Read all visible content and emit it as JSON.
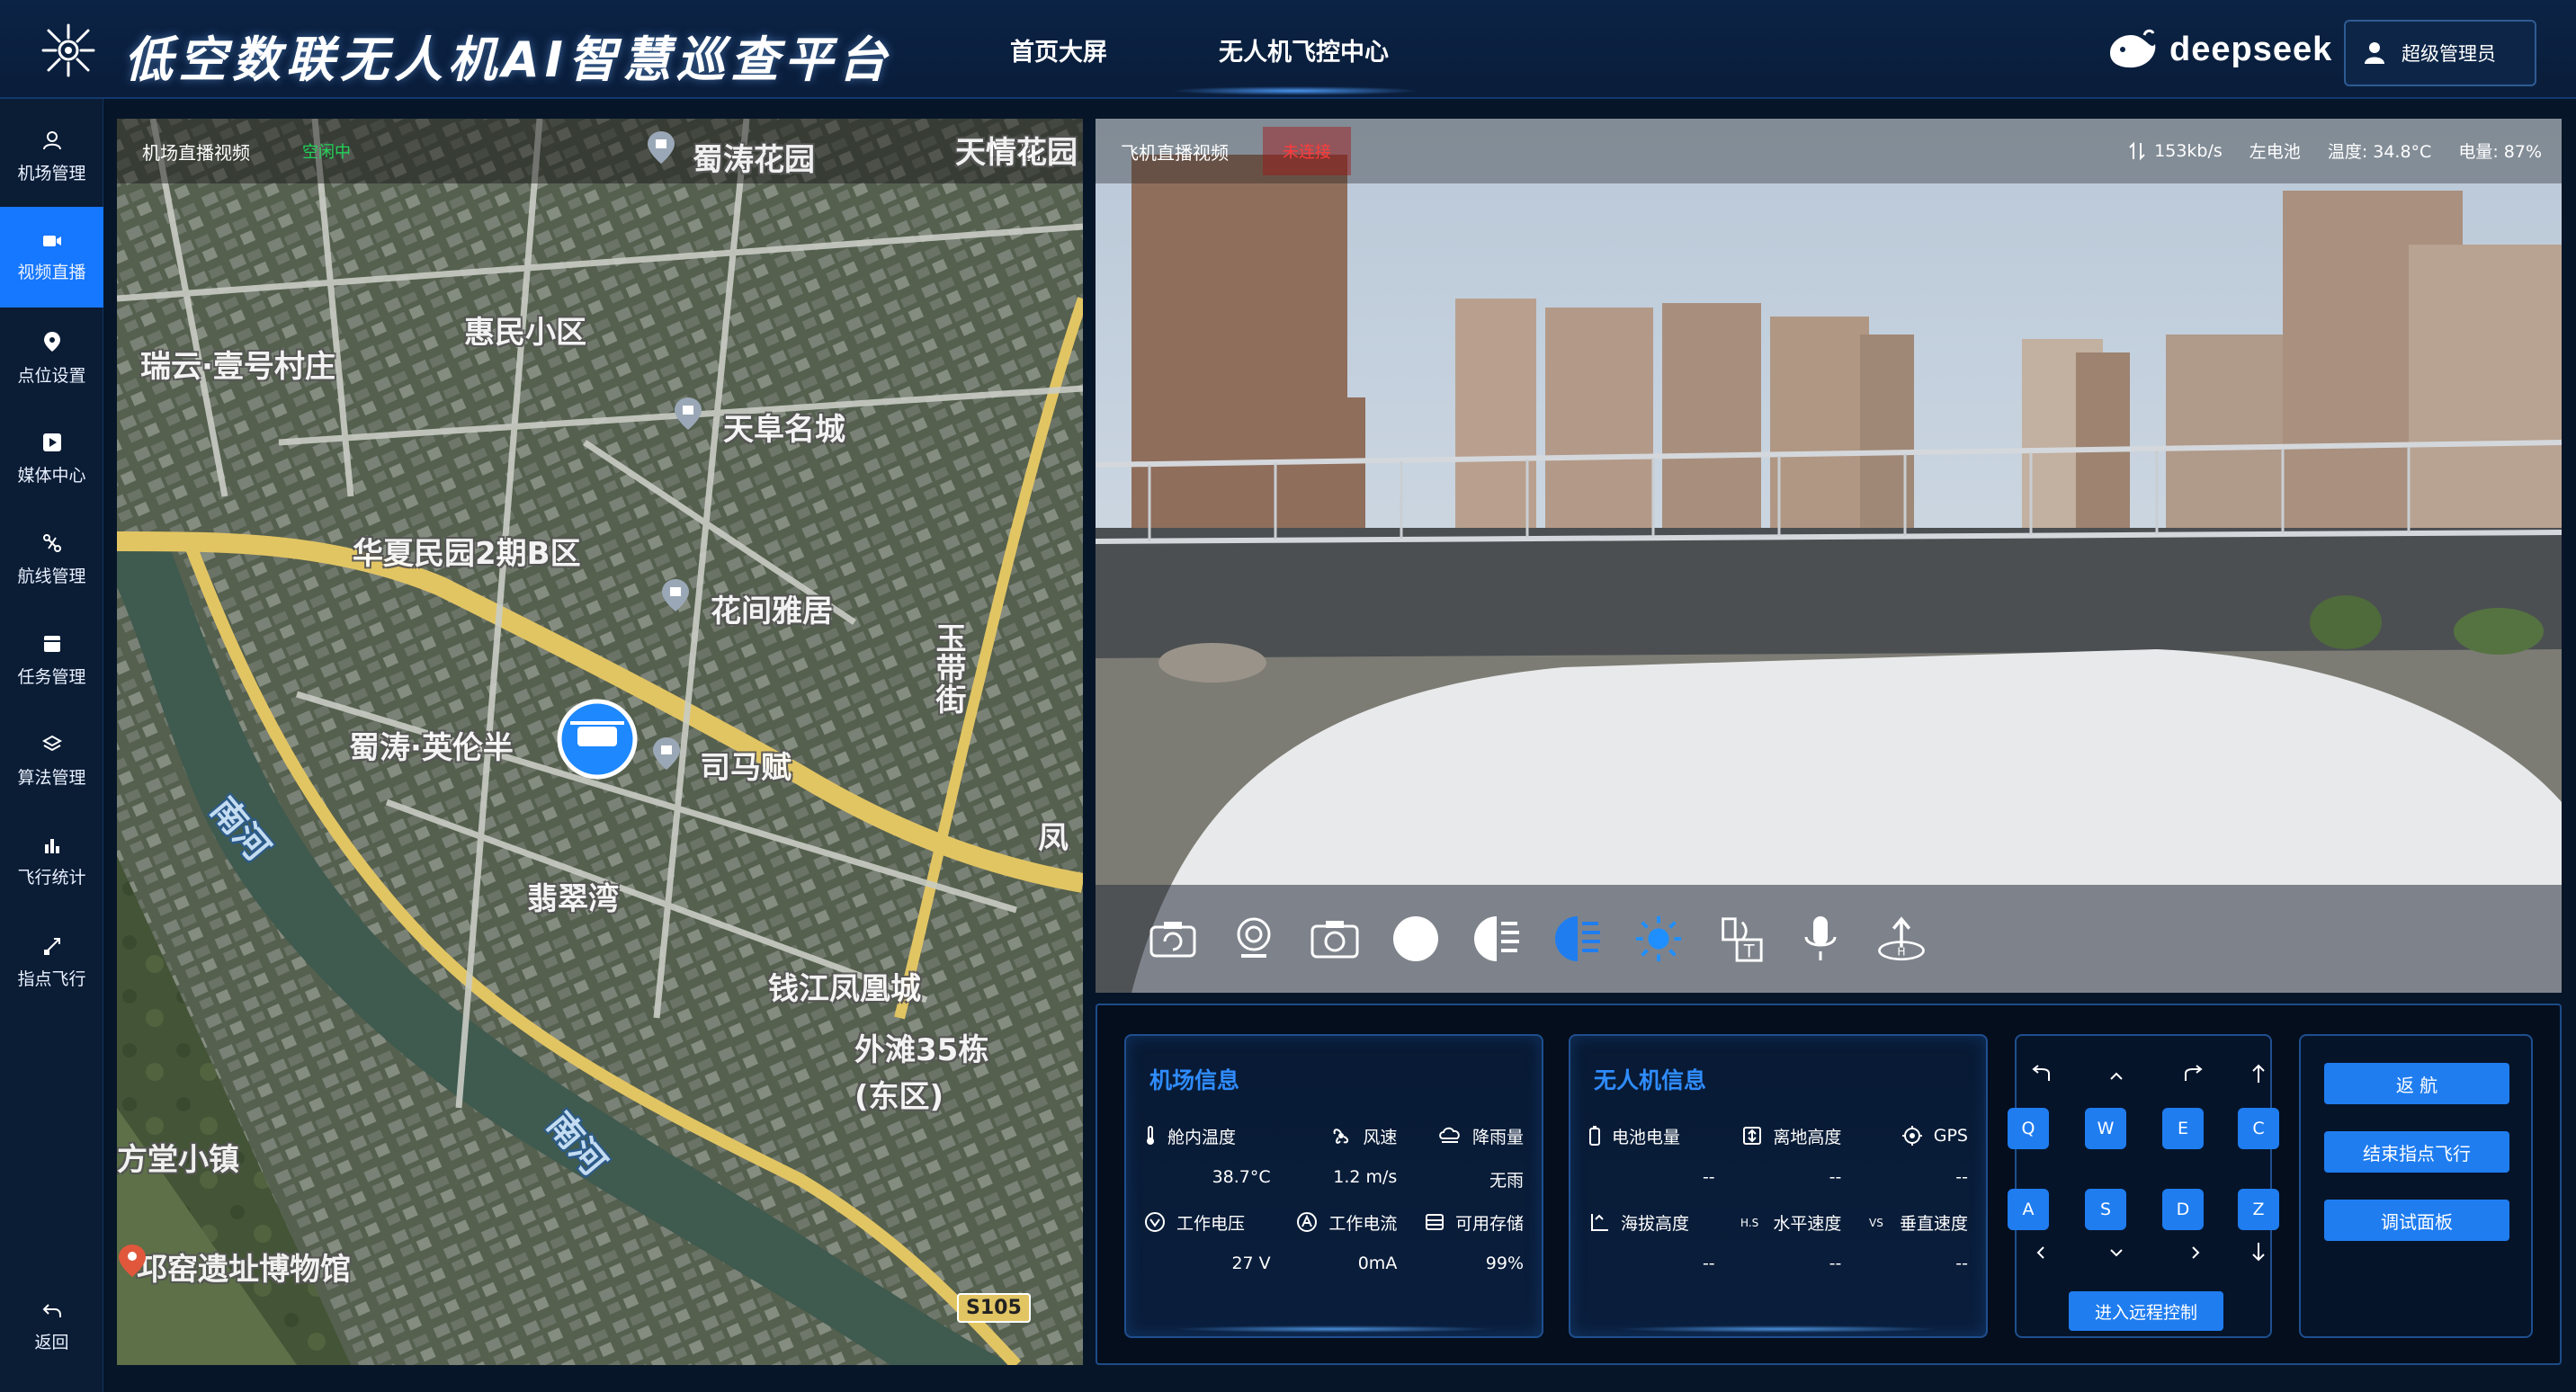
{
  "header": {
    "title": "低空数联无人机AI智慧巡查平台",
    "nav": [
      {
        "label": "首页大屏"
      },
      {
        "label": "无人机飞控中心"
      }
    ],
    "brand": "deepseek",
    "user": "超级管理员"
  },
  "sidebar": {
    "items": [
      {
        "label": "机场管理",
        "icon": "drone-user-icon"
      },
      {
        "label": "视频直播",
        "icon": "video-icon",
        "active": true
      },
      {
        "label": "点位设置",
        "icon": "location-pin-icon"
      },
      {
        "label": "媒体中心",
        "icon": "media-play-icon"
      },
      {
        "label": "航线管理",
        "icon": "route-icon"
      },
      {
        "label": "任务管理",
        "icon": "task-icon"
      },
      {
        "label": "算法管理",
        "icon": "algorithm-icon"
      },
      {
        "label": "飞行统计",
        "icon": "bar-chart-icon"
      },
      {
        "label": "指点飞行",
        "icon": "point-flight-icon"
      }
    ],
    "back": "返回"
  },
  "map_panel": {
    "title": "机场直播视频",
    "status": "空闲中",
    "labels": [
      {
        "text": "蜀涛花园"
      },
      {
        "text": "天情花园"
      },
      {
        "text": "瑞云·壹号村庄"
      },
      {
        "text": "惠民小区"
      },
      {
        "text": "天阜名城"
      },
      {
        "text": "华夏民园2期B区"
      },
      {
        "text": "花间雅居"
      },
      {
        "text": "玉带街"
      },
      {
        "text": "蜀涛·英伦半"
      },
      {
        "text": "司马赋"
      },
      {
        "text": "凤"
      },
      {
        "text": "翡翠湾"
      },
      {
        "text": "钱江凤凰城"
      },
      {
        "text": "外滩35栋(东区)"
      },
      {
        "text": "方堂小镇"
      },
      {
        "text": "邛窑遗址博物馆"
      },
      {
        "text": "南河"
      },
      {
        "text": "南河"
      },
      {
        "text": "S105"
      }
    ]
  },
  "video_panel": {
    "title": "飞机直播视频",
    "status": "未连接",
    "bitrate": "153kb/s",
    "battery_side": "左电池",
    "temperature": "温度: 34.8°C",
    "battery_level": "电量: 87%",
    "toolbar": [
      "camera-switch-icon",
      "record-icon",
      "snapshot-icon",
      "dot-icon",
      "half-moon-icon",
      "fill-light-icon",
      "sun-icon",
      "voice-text-icon",
      "microphone-icon",
      "takeoff-icon"
    ]
  },
  "airport_info": {
    "title": "机场信息",
    "metrics": [
      {
        "label": "舱内温度",
        "value": "38.7°C",
        "icon": "thermometer-icon"
      },
      {
        "label": "风速",
        "value": "1.2 m/s",
        "icon": "fan-icon"
      },
      {
        "label": "降雨量",
        "value": "无雨",
        "icon": "cloud-rain-icon"
      },
      {
        "label": "工作电压",
        "value": "27 V",
        "icon": "voltage-icon"
      },
      {
        "label": "工作电流",
        "value": "0mA",
        "icon": "current-icon"
      },
      {
        "label": "可用存储",
        "value": "99%",
        "icon": "storage-icon"
      }
    ]
  },
  "drone_info": {
    "title": "无人机信息",
    "metrics": [
      {
        "label": "电池电量",
        "value": "--",
        "icon": "battery-icon"
      },
      {
        "label": "离地高度",
        "value": "--",
        "icon": "height-icon"
      },
      {
        "label": "GPS",
        "value": "--",
        "icon": "gps-icon"
      },
      {
        "label": "海拔高度",
        "value": "--",
        "icon": "altitude-icon"
      },
      {
        "label": "水平速度",
        "value": "--",
        "icon": "h-speed-icon"
      },
      {
        "label": "垂直速度",
        "value": "--",
        "icon": "v-speed-icon"
      }
    ]
  },
  "remote": {
    "keys": [
      "Q",
      "W",
      "E",
      "C",
      "A",
      "S",
      "D",
      "Z"
    ],
    "enter_label": "进入远程控制"
  },
  "actions": {
    "return_label": "返 航",
    "end_label": "结束指点飞行",
    "debug_label": "调试面板"
  }
}
